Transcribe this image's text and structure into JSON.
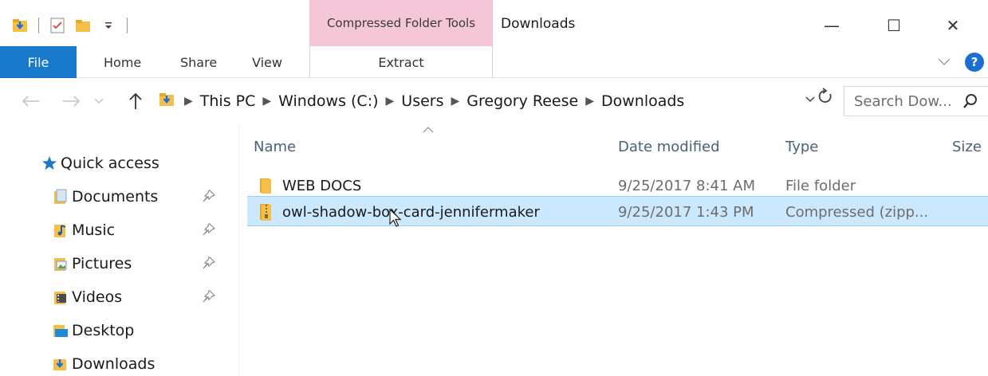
{
  "window": {
    "title": "Downloads",
    "contextual_tab_label": "Compressed Folder Tools",
    "controls": {
      "minimize": "—",
      "maximize": "☐",
      "close": "✕"
    }
  },
  "ribbon": {
    "tabs": [
      {
        "label": "File"
      },
      {
        "label": "Home"
      },
      {
        "label": "Share"
      },
      {
        "label": "View"
      },
      {
        "label": "Extract"
      }
    ],
    "help_label": "?",
    "accent": "#1979ca",
    "contextual_color": "#f5c6d8"
  },
  "address": {
    "breadcrumbs": [
      "This PC",
      "Windows (C:)",
      "Users",
      "Gregory Reese",
      "Downloads"
    ],
    "search_placeholder": "Search Dow..."
  },
  "nav_pane": {
    "quick_access_label": "Quick access",
    "items": [
      {
        "label": "Documents",
        "icon": "documents-folder-icon",
        "pinned": true
      },
      {
        "label": "Music",
        "icon": "music-folder-icon",
        "pinned": true
      },
      {
        "label": "Pictures",
        "icon": "pictures-folder-icon",
        "pinned": true
      },
      {
        "label": "Videos",
        "icon": "videos-folder-icon",
        "pinned": true
      },
      {
        "label": "Desktop",
        "icon": "desktop-folder-icon",
        "pinned": false
      },
      {
        "label": "Downloads",
        "icon": "downloads-folder-icon",
        "pinned": false
      }
    ]
  },
  "file_list": {
    "columns": [
      "Name",
      "Date modified",
      "Type",
      "Size"
    ],
    "rows": [
      {
        "name": "WEB DOCS",
        "date": "9/25/2017 8:41 AM",
        "type": "File folder",
        "icon": "folder-icon",
        "selected": false
      },
      {
        "name": "owl-shadow-box-card-jennifermaker",
        "date": "9/25/2017 1:43 PM",
        "type": "Compressed (zipp...",
        "icon": "zip-folder-icon",
        "selected": true
      }
    ],
    "selection_color": "#cce8ff"
  }
}
